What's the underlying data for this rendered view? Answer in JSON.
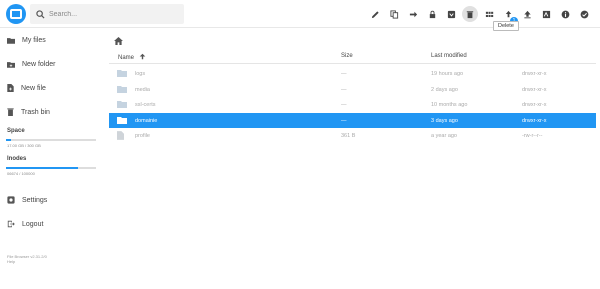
{
  "search": {
    "placeholder": "Search..."
  },
  "toolbar": {
    "tooltip": "Delete",
    "upload_badge": "1"
  },
  "sidebar": {
    "items": [
      {
        "label": "My files",
        "icon": "folder-icon"
      },
      {
        "label": "New folder",
        "icon": "new-folder-icon"
      },
      {
        "label": "New file",
        "icon": "new-file-icon"
      },
      {
        "label": "Trash bin",
        "icon": "trash-icon"
      }
    ],
    "space": {
      "label": "Space",
      "value": "17.00 GB / 300 GB",
      "fraction": 0.06
    },
    "inodes": {
      "label": "Inodes",
      "value": "06674 / 100000",
      "fraction": 0.8
    },
    "bottom": [
      {
        "label": "Settings",
        "icon": "settings-icon"
      },
      {
        "label": "Logout",
        "icon": "logout-icon"
      }
    ],
    "credits": [
      "File Browser v2.31.2/0",
      "Help"
    ]
  },
  "listing": {
    "columns": {
      "name": "Name",
      "size": "Size",
      "modified": "Last modified"
    },
    "rows": [
      {
        "name": "logs",
        "size": "—",
        "modified": "19 hours ago",
        "perms": "drwxr-xr-x",
        "type": "folder",
        "selected": false
      },
      {
        "name": "media",
        "size": "—",
        "modified": "2 days ago",
        "perms": "drwxr-xr-x",
        "type": "folder",
        "selected": false
      },
      {
        "name": "ssl-certs",
        "size": "—",
        "modified": "10 months ago",
        "perms": "drwxr-xr-x",
        "type": "folder",
        "selected": false
      },
      {
        "name": "domainie",
        "size": "—",
        "modified": "3 days ago",
        "perms": "drwxr-xr-x",
        "type": "folder",
        "selected": true
      },
      {
        "name": "profile",
        "size": "361 B",
        "modified": "a year ago",
        "perms": "-rw-r--r--",
        "type": "file",
        "selected": false
      }
    ]
  },
  "colors": {
    "accent": "#2196f3"
  }
}
